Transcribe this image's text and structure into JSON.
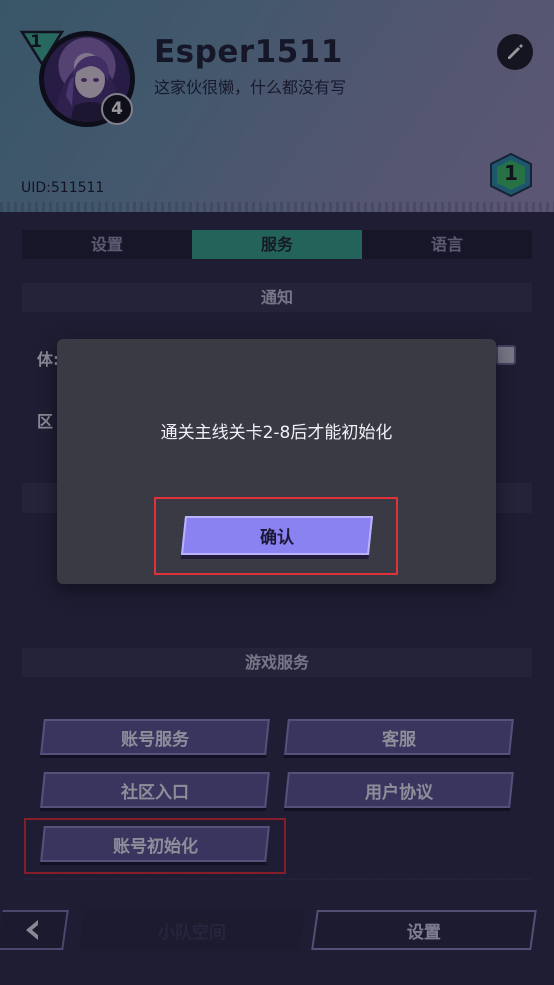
{
  "profile": {
    "username": "Esper1511",
    "signature": "这家伙很懒，什么都没有写",
    "uid": "UID:511511",
    "rank": "1",
    "level": "4",
    "hex_badge": "1",
    "avatar_icon": "character-portrait",
    "edit_icon": "pencil-icon"
  },
  "tabs": [
    {
      "label": "设置",
      "active": false
    },
    {
      "label": "服务",
      "active": true
    },
    {
      "label": "语言",
      "active": false
    }
  ],
  "notification": {
    "title": "通知",
    "row1_label": "体:",
    "row2_label": "区"
  },
  "game_services": {
    "title": "游戏服务",
    "buttons": [
      "账号服务",
      "客服",
      "社区入口",
      "用户协议",
      "账号初始化"
    ]
  },
  "footer_text": "——————————————————————————————————————————————————",
  "bottom_nav": {
    "back_icon": "chevron-left-icon",
    "home_label": "小队空间",
    "settings_label": "设置"
  },
  "dialog": {
    "message": "通关主线关卡2-8后才能初始化",
    "confirm_label": "确认"
  },
  "colors": {
    "accent_tab": "#3aa58c",
    "button": "#5d5796",
    "confirm": "#8a82f0",
    "highlight": "#e0303a"
  }
}
